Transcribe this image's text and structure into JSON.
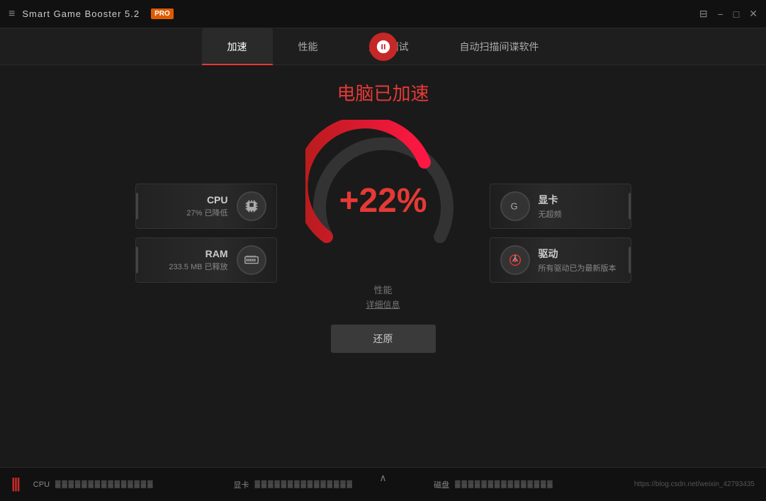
{
  "titlebar": {
    "title": "Smart Game Booster 5.2",
    "pro_badge": "PRO",
    "hamburger": "≡",
    "controls": {
      "screenshot": "⊟",
      "minimize": "−",
      "maximize": "□",
      "close": "✕"
    }
  },
  "nav": {
    "tabs": [
      {
        "label": "加速",
        "active": true
      },
      {
        "label": "性能",
        "active": false
      },
      {
        "label": "运行测试",
        "active": false
      },
      {
        "label": "自动扫描间谍软件",
        "active": false
      }
    ]
  },
  "main": {
    "status_title": "电脑已加速",
    "gauge_value": "+22%",
    "perf_label": "性能",
    "detail_link": "详细信息",
    "left_panels": [
      {
        "label": "CPU",
        "sub": "27% 已降低"
      },
      {
        "label": "RAM",
        "sub": "233.5 MB 已释放"
      }
    ],
    "right_panels": [
      {
        "label": "显卡",
        "sub": "无超频"
      },
      {
        "label": "驱动",
        "sub": "所有驱动已为最新版本"
      }
    ],
    "restore_button": "还原"
  },
  "bottom": {
    "logo": "|||",
    "items": [
      {
        "label": "CPU",
        "dots": "▓▓▓▓▓▓▓▓▓▓▓▓▓▓▓"
      },
      {
        "label": "显卡",
        "dots": "▓▓▓▓▓▓▓▓▓▓▓▓▓▓▓"
      },
      {
        "label": "磁盘",
        "dots": "▓▓▓▓▓▓▓▓▓▓▓▓▓▓▓"
      }
    ],
    "watermark": "https://blog.csdn.net/weixin_42793435"
  }
}
